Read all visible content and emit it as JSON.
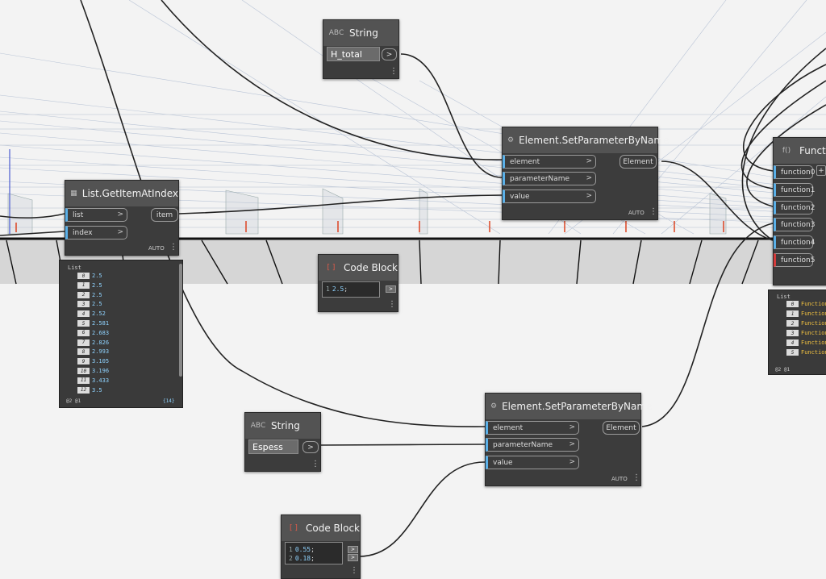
{
  "nodes": {
    "string_top": {
      "icon": "ABC",
      "title": "String",
      "value": "H_total",
      "out": ">"
    },
    "setparam_top": {
      "icon": "⚙",
      "title": "Element.SetParameterByName",
      "inputs": [
        "element",
        "parameterName",
        "value"
      ],
      "output": "Element",
      "auto": "AUTO"
    },
    "getitem": {
      "icon": "▦",
      "title": "List.GetItemAtIndex",
      "inputs": [
        "list",
        "index"
      ],
      "output": "item",
      "auto": "AUTO"
    },
    "function_right": {
      "icon": "f()",
      "title": "Functio",
      "inputs": [
        "function0",
        "function1",
        "function2",
        "function3",
        "function4",
        "function5"
      ],
      "plus": "+"
    },
    "codeblock_mid": {
      "icon": "[ ]",
      "title": "Code Block",
      "lines": [
        {
          "ln": "1",
          "num": "2.5",
          "pun": ";"
        }
      ],
      "out": ">"
    },
    "setparam_bottom": {
      "icon": "⚙",
      "title": "Element.SetParameterByName",
      "inputs": [
        "element",
        "parameterName",
        "value"
      ],
      "output": "Element",
      "auto": "AUTO"
    },
    "string_bottom": {
      "icon": "ABC",
      "title": "String",
      "value": "Espess",
      "out": ">"
    },
    "codeblock_bottom": {
      "icon": "[ ]",
      "title": "Code Block",
      "lines": [
        {
          "ln": "1",
          "num": "0.55",
          "pun": ";"
        },
        {
          "ln": "2",
          "num": "0.18",
          "pun": ";"
        }
      ],
      "out": ">"
    }
  },
  "preview_list": {
    "label": "List",
    "items": [
      {
        "i": "0",
        "v": "2.5"
      },
      {
        "i": "1",
        "v": "2.5"
      },
      {
        "i": "2",
        "v": "2.5"
      },
      {
        "i": "3",
        "v": "2.5"
      },
      {
        "i": "4",
        "v": "2.52"
      },
      {
        "i": "5",
        "v": "2.581"
      },
      {
        "i": "6",
        "v": "2.683"
      },
      {
        "i": "7",
        "v": "2.826"
      },
      {
        "i": "8",
        "v": "2.993"
      },
      {
        "i": "9",
        "v": "3.105"
      },
      {
        "i": "10",
        "v": "3.196"
      },
      {
        "i": "11",
        "v": "3.433"
      },
      {
        "i": "12",
        "v": "3.5"
      }
    ],
    "levels": "@2 @1",
    "count": "{14}"
  },
  "preview_functions": {
    "label": "List",
    "items": [
      {
        "i": "0",
        "v": "Function"
      },
      {
        "i": "1",
        "v": "Function"
      },
      {
        "i": "2",
        "v": "Function"
      },
      {
        "i": "3",
        "v": "Function"
      },
      {
        "i": "4",
        "v": "Function"
      },
      {
        "i": "5",
        "v": "Function"
      }
    ],
    "levels": "@2 @1"
  },
  "menu_dots": "⋮"
}
